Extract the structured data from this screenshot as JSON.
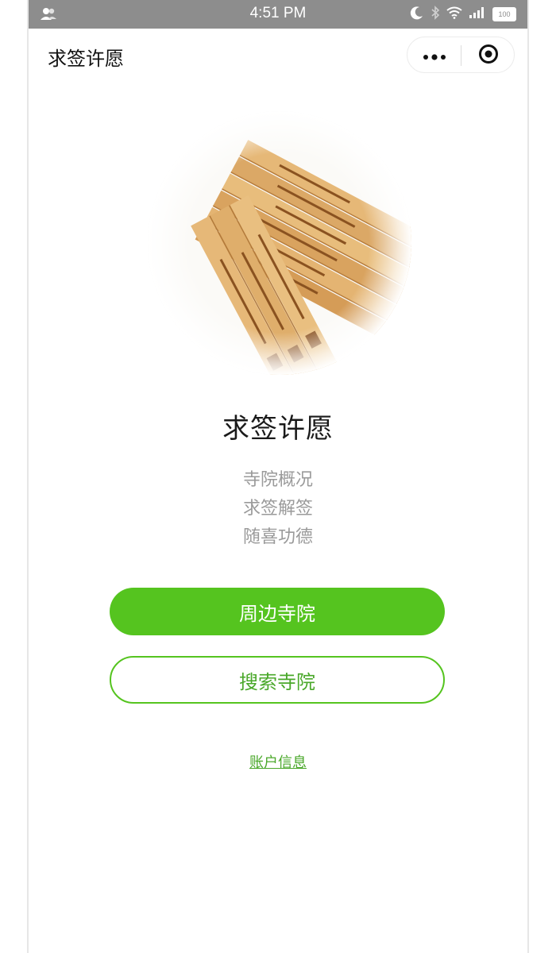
{
  "status_bar": {
    "time": "4:51 PM",
    "battery": "100",
    "left_icon": "person-icon",
    "right_icons": [
      "moon-icon",
      "bluetooth-icon",
      "wifi-icon",
      "signal-icon",
      "battery-icon"
    ]
  },
  "nav": {
    "title": "求签许愿",
    "more_icon": "more-dots-icon",
    "close_icon": "close-target-icon"
  },
  "hero": {
    "icon": "divination-sticks-image"
  },
  "main": {
    "title": "求签许愿",
    "features": [
      "寺院概况",
      "求签解签",
      "随喜功德"
    ]
  },
  "buttons": {
    "nearby_temples": "周边寺院",
    "search_temples": "搜索寺院"
  },
  "footer": {
    "account_link": "账户信息"
  },
  "colors": {
    "accent": "#55c41f",
    "accent_text": "#4aa82a",
    "status_bar": "#8d8d8d",
    "feature_text": "#9a9a9a"
  }
}
